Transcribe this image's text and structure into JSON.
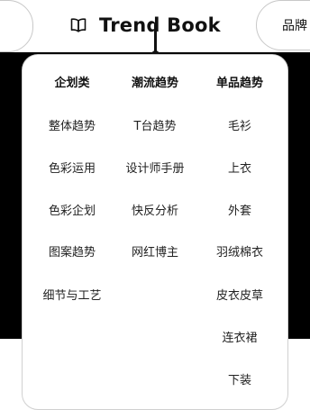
{
  "nav": {
    "brand": "Trend Book",
    "brand_icon": "open-book-icon",
    "right_item": "品牌"
  },
  "menu": {
    "columns": [
      {
        "heading": "企划类",
        "items": [
          "整体趋势",
          "色彩运用",
          "色彩企划",
          "图案趋势",
          "细节与工艺"
        ]
      },
      {
        "heading": "潮流趋势",
        "items": [
          "T台趋势",
          "设计师手册",
          "快反分析",
          "网红博主"
        ]
      },
      {
        "heading": "单品趋势",
        "items": [
          "毛衫",
          "上衣",
          "外套",
          "羽绒棉衣",
          "皮衣皮草",
          "连衣裙",
          "下装"
        ]
      }
    ]
  },
  "colors": {
    "backdrop": "#000000",
    "text": "#111111",
    "border": "#d0d0d0"
  }
}
